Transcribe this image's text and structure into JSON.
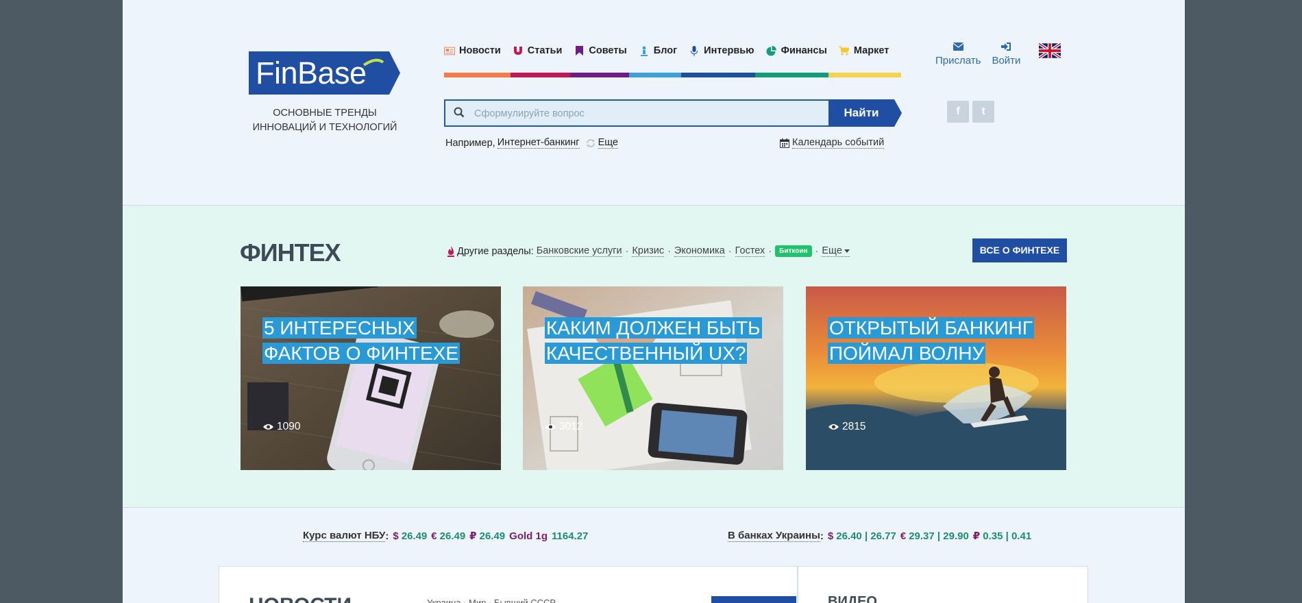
{
  "header": {
    "logo_text": "FinBase",
    "tagline_line1": "ОСНОВНЫЕ ТРЕНДЫ",
    "tagline_line2": "ИННОВАЦИЙ И ТЕХНОЛОГИЙ",
    "nav": [
      {
        "label": "Новости",
        "icon": "newspaper-icon"
      },
      {
        "label": "Статьи",
        "icon": "magnet-icon"
      },
      {
        "label": "Советы",
        "icon": "bookmark-icon"
      },
      {
        "label": "Блог",
        "icon": "person-icon"
      },
      {
        "label": "Интервью",
        "icon": "microphone-icon"
      },
      {
        "label": "Финансы",
        "icon": "pie-chart-icon"
      },
      {
        "label": "Маркет",
        "icon": "cart-icon"
      }
    ],
    "nav_colors": [
      "#f47b4a",
      "#c11856",
      "#6c1e86",
      "#3ea1da",
      "#1d4fa0",
      "#149a7e",
      "#f6d34c"
    ],
    "search": {
      "placeholder": "Сформулируйте вопрос",
      "button_label": "Найти"
    },
    "examples": {
      "prefix": "Например,",
      "example_link": "Интернет-банкинг",
      "more_label": "Еще"
    },
    "calendar_label": "Календарь событий",
    "user_links": {
      "send_label": "Прислать",
      "login_label": "Войти"
    },
    "socials": [
      "f",
      "t"
    ]
  },
  "fintech": {
    "title": "ФИНТЕХ",
    "other_prefix": "Другие разделы:",
    "links": [
      "Банковские услуги",
      "Кризис",
      "Экономика",
      "Гостех"
    ],
    "badge": "Биткоин",
    "more_label": "Еще",
    "all_button": "ВСЕ О ФИНТЕХЕ",
    "cards": [
      {
        "title": "5 интересных фактов о финтехе",
        "views": "1090"
      },
      {
        "title": "Каким должен быть качественный UX?",
        "views": "3012"
      },
      {
        "title": "Открытый банкинг поймал волну",
        "views": "2815"
      }
    ]
  },
  "rates": {
    "nbu_label": "Курс валют НБУ",
    "nbu_usd": "26.49",
    "nbu_eur": "26.49",
    "nbu_rub": "26.49",
    "gold_label": "Gold 1g",
    "gold_value": "1164.27",
    "banks_label": "В банках Украины",
    "banks_usd": "26.40 | 26.77",
    "banks_eur": "29.37 | 29.90",
    "banks_rub": "0.35 | 0.41"
  },
  "lower": {
    "news_title": "НОВОСТИ",
    "news_tabs": "Украина · Мир · Бывший СССР",
    "video_title": "ВИДЕО"
  }
}
